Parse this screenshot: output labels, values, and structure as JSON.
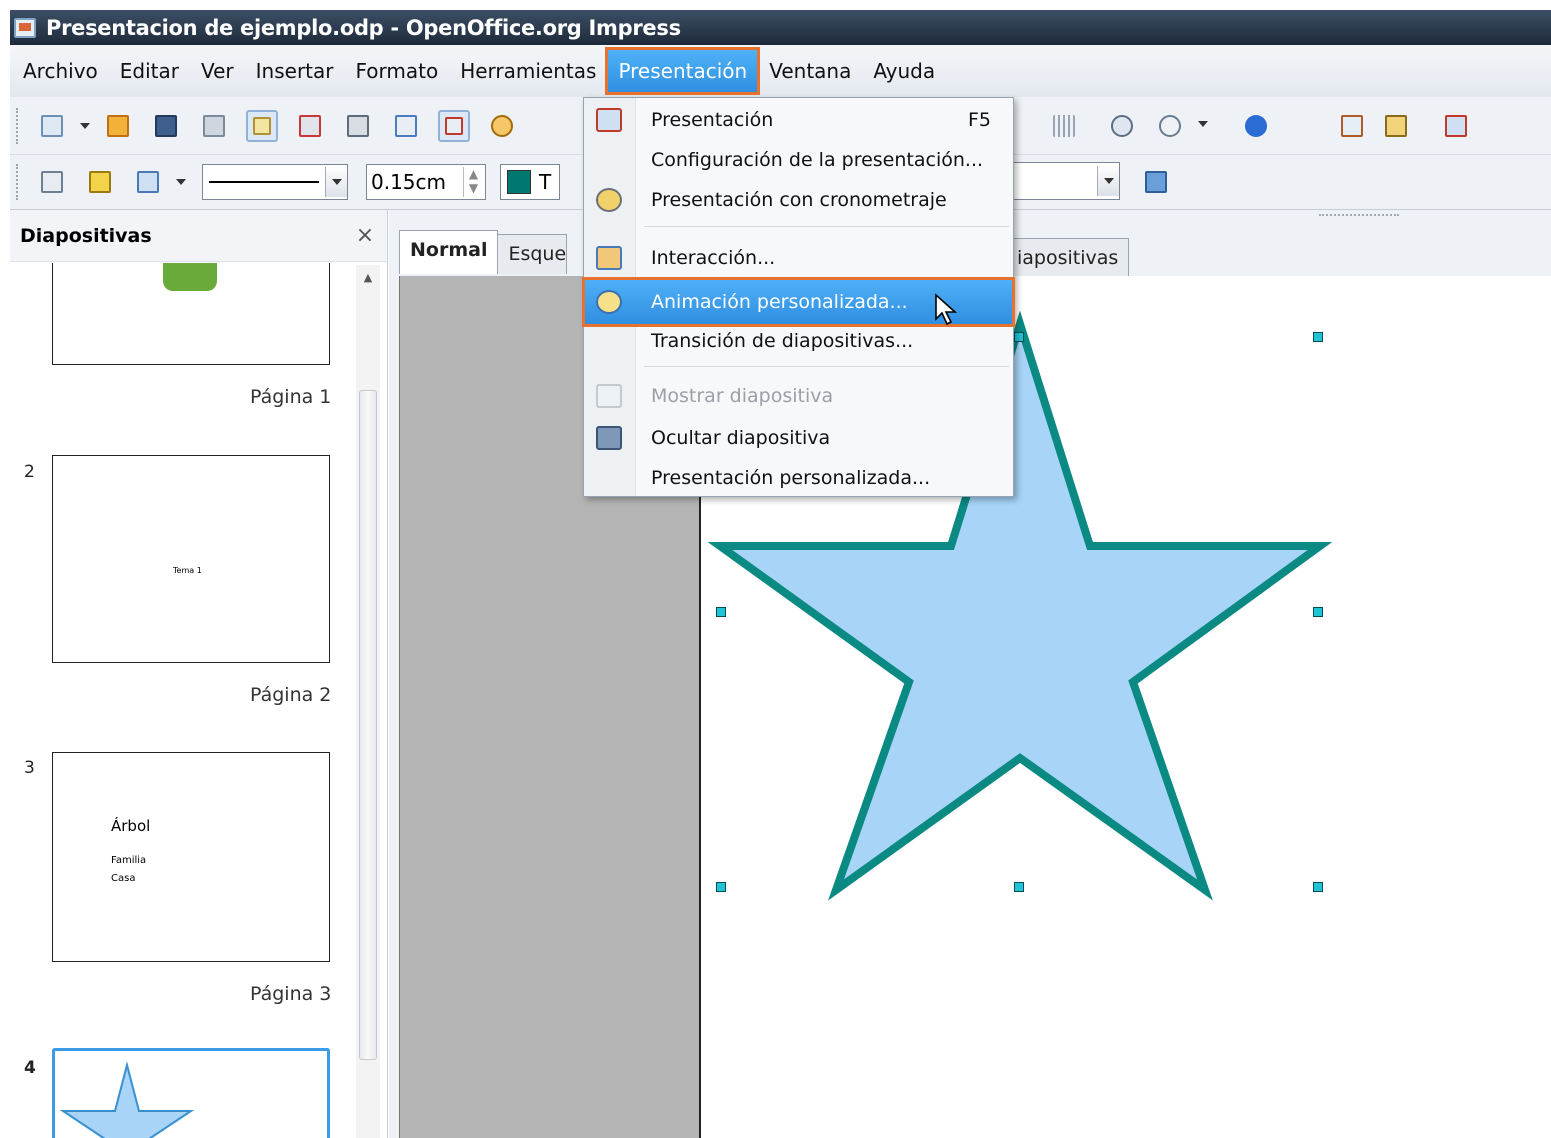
{
  "window": {
    "title": "Presentacion de ejemplo.odp - OpenOffice.org Impress"
  },
  "menubar": {
    "items": [
      "Archivo",
      "Editar",
      "Ver",
      "Insertar",
      "Formato",
      "Herramientas",
      "Presentación",
      "Ventana",
      "Ayuda"
    ],
    "active": "Presentación"
  },
  "toolbar2": {
    "line_width": "0.15cm",
    "area_color_label": "T",
    "area_color": "#00776f"
  },
  "slides_pane": {
    "title": "Diapositivas",
    "close": "×",
    "slides": [
      {
        "label": "Página 1"
      },
      {
        "number": "2",
        "label": "Página 2",
        "text": "Tema 1"
      },
      {
        "number": "3",
        "label": "Página 3",
        "title": "Árbol",
        "lines": [
          "Familia",
          "Casa"
        ]
      },
      {
        "number": "4"
      }
    ]
  },
  "view_tabs": {
    "normal": "Normal",
    "outline": "Esquer",
    "sorter": "iapositivas"
  },
  "dropdown": {
    "items": [
      {
        "label": "Presentación",
        "shortcut": "F5"
      },
      {
        "label": "Configuración de la presentación..."
      },
      {
        "label": "Presentación con cronometraje"
      },
      {
        "label": "Interacción..."
      },
      {
        "label": "Animación personalizada...",
        "state": "highlighted"
      },
      {
        "label": "Transición de diapositivas..."
      },
      {
        "label": "Mostrar diapositiva",
        "state": "disabled"
      },
      {
        "label": "Ocultar diapositiva"
      },
      {
        "label": "Presentación personalizada..."
      }
    ]
  },
  "colors": {
    "accent_highlight": "#e6722e",
    "menu_selected": "#3a9de9",
    "star_fill": "#a7d4f7",
    "star_stroke": "#0a8a82"
  }
}
